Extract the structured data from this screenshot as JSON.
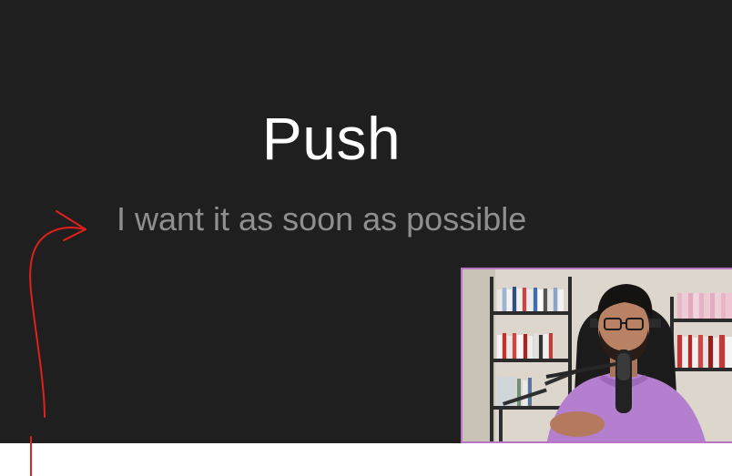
{
  "slide": {
    "title": "Push",
    "subtitle": "I want it as soon as possible"
  },
  "colors": {
    "slide_background": "#201f20",
    "title_text": "#ffffff",
    "subtitle_text": "#8f8f8f",
    "annotation_stroke": "#e0201c",
    "webcam_border": "#b974c6",
    "presenter_shirt": "#b57fcf"
  },
  "icons": {
    "annotation": "red-curved-arrow-icon",
    "webcam": "presenter-webcam-overlay"
  }
}
